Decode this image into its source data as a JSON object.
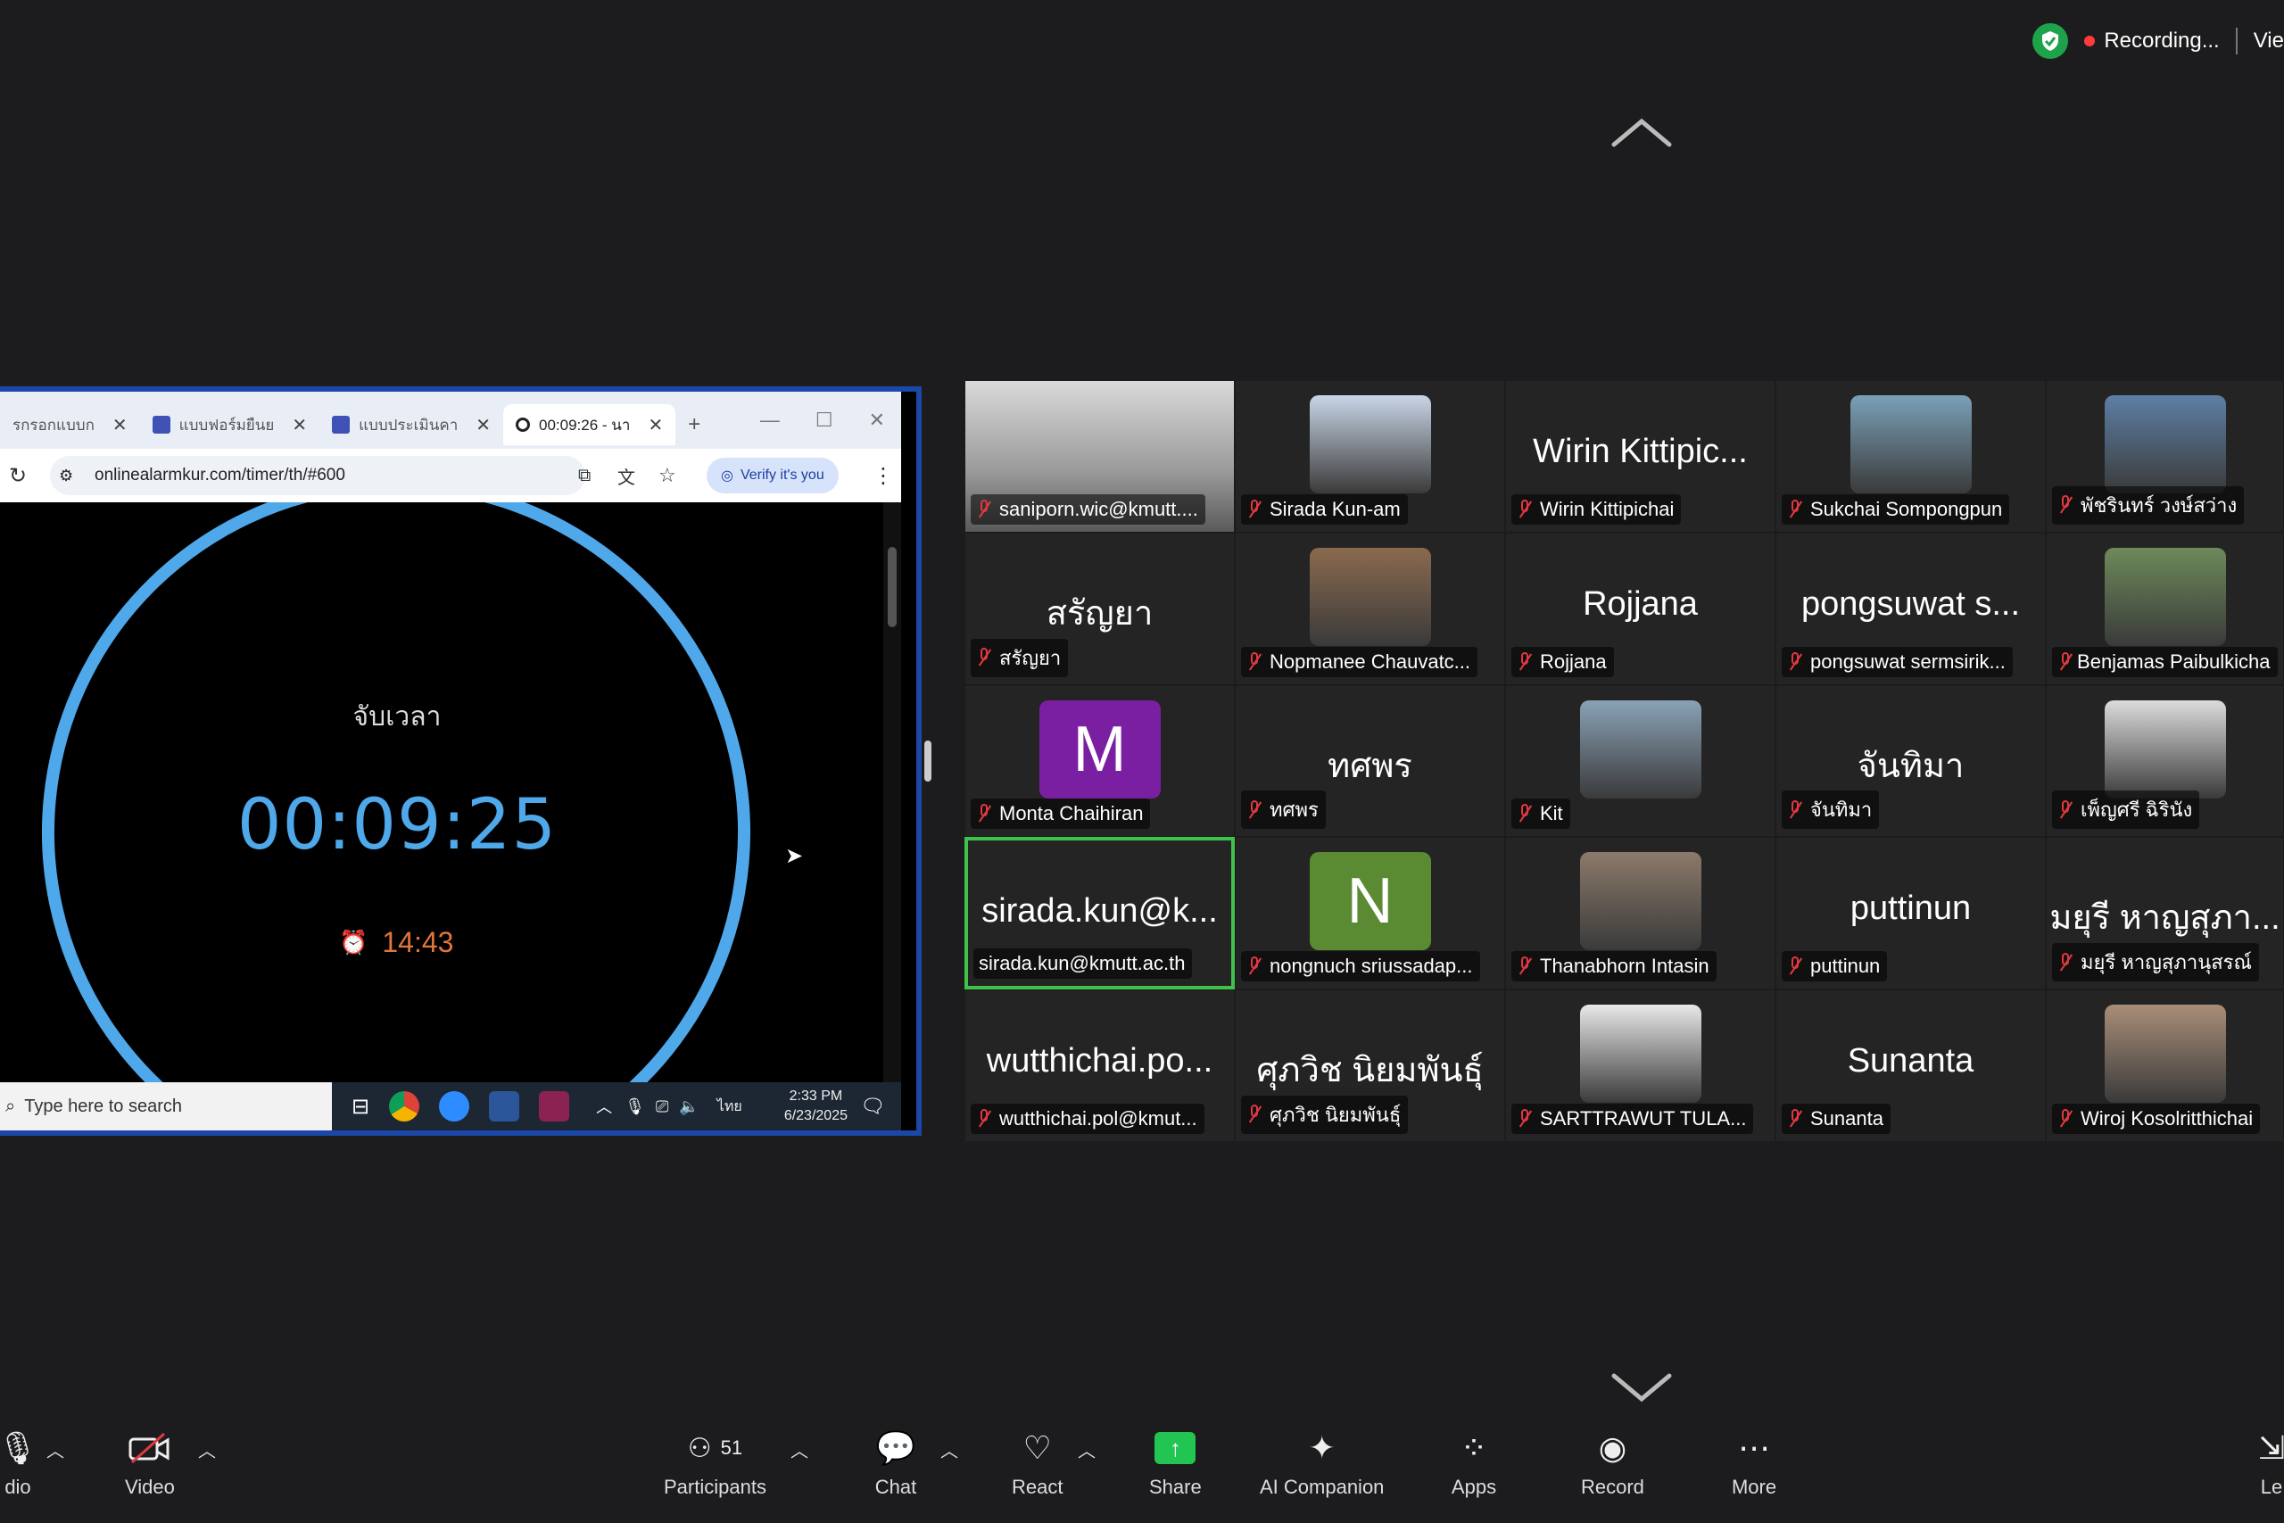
{
  "topbar": {
    "recording_label": "Recording...",
    "view_label": "Vie"
  },
  "browser": {
    "tabs": [
      {
        "label": "รกรอกแบบก",
        "active": false
      },
      {
        "label": "แบบฟอร์มยืนย",
        "active": false
      },
      {
        "label": "แบบประเมินคา",
        "active": false
      },
      {
        "label": "00:09:26 - นา",
        "active": true
      }
    ],
    "new_tab": "+",
    "url": "onlinealarmkur.com/timer/th/#600",
    "verify_label": "Verify it's you"
  },
  "timer": {
    "label": "จับเวลา",
    "value": "00:09:25",
    "alarm_time": "14:43",
    "progress": 0.95
  },
  "taskbar": {
    "search_placeholder": "Type here to search",
    "lang": "ไทย",
    "time": "2:33 PM",
    "date": "6/23/2025"
  },
  "participants": [
    {
      "big": "",
      "name": "saniporn.wic@kmutt....",
      "type": "webcam"
    },
    {
      "big": "",
      "name": "Sirada Kun-am",
      "type": "photo",
      "color": "#c9d6e8"
    },
    {
      "big": "Wirin Kittipic...",
      "name": "Wirin Kittipichai",
      "type": "text"
    },
    {
      "big": "",
      "name": "Sukchai Sompongpun",
      "type": "photo",
      "color": "#7aa0b8"
    },
    {
      "big": "",
      "name": "พัชรินทร์ วงษ์สว่าง",
      "type": "photo",
      "color": "#5d7fa5"
    },
    {
      "big": "สรัญยา",
      "name": "สรัญยา",
      "type": "text"
    },
    {
      "big": "",
      "name": "Nopmanee Chauvatc...",
      "type": "photo",
      "color": "#8a6a4e"
    },
    {
      "big": "Rojjana",
      "name": "Rojjana",
      "type": "text"
    },
    {
      "big": "pongsuwat  s...",
      "name": "pongsuwat  sermsirik...",
      "type": "text"
    },
    {
      "big": "",
      "name": "Benjamas Paibulkicha",
      "type": "photo",
      "color": "#6d8a5a"
    },
    {
      "big": "M",
      "name": "Monta Chaihiran",
      "type": "letter",
      "color": "#7b1fa2"
    },
    {
      "big": "ทศพร",
      "name": "ทศพร",
      "type": "text"
    },
    {
      "big": "",
      "name": "Kit",
      "type": "photo",
      "color": "#8aa2b6"
    },
    {
      "big": "จันทิมา",
      "name": "จันทิมา",
      "type": "text"
    },
    {
      "big": "",
      "name": "เพ็ญศรี ฉิรินัง",
      "type": "photo",
      "color": "#dcdcdc"
    },
    {
      "big": "sirada.kun@k...",
      "name": "sirada.kun@kmutt.ac.th",
      "type": "text",
      "active": true
    },
    {
      "big": "N",
      "name": "nongnuch sriussadap...",
      "type": "letter",
      "color": "#5a8a32"
    },
    {
      "big": "",
      "name": "Thanabhorn Intasin",
      "type": "photo",
      "color": "#8c7a6a"
    },
    {
      "big": "puttinun",
      "name": "puttinun",
      "type": "text"
    },
    {
      "big": "มยุรี หาญสุภา...",
      "name": "มยุรี หาญสุภานุสรณ์",
      "type": "text"
    },
    {
      "big": "wutthichai.po...",
      "name": "wutthichai.pol@kmut...",
      "type": "text"
    },
    {
      "big": "ศุภวิช นิยมพันธุ์",
      "name": "ศุภวิช นิยมพันธุ์",
      "type": "text"
    },
    {
      "big": "",
      "name": "SARTTRAWUT TULA...",
      "type": "photo",
      "color": "#e8e8e8"
    },
    {
      "big": "Sunanta",
      "name": "Sunanta",
      "type": "text"
    },
    {
      "big": "",
      "name": "Wiroj Kosolritthichai",
      "type": "photo",
      "color": "#a98e78"
    }
  ],
  "toolbar": {
    "audio": "dio",
    "video": "Video",
    "participants": "Participants",
    "participants_count": "51",
    "chat": "Chat",
    "react": "React",
    "share": "Share",
    "ai": "AI Companion",
    "apps": "Apps",
    "record": "Record",
    "more": "More",
    "leave": "Le"
  }
}
